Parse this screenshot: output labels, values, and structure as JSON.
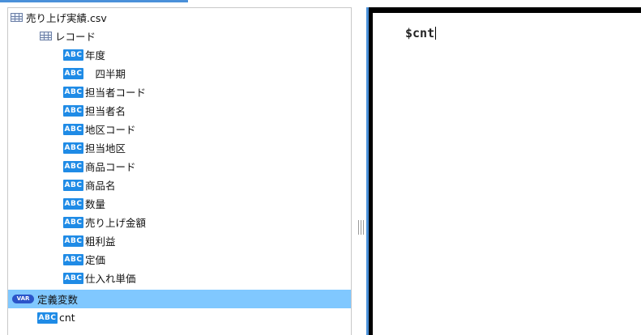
{
  "tree": {
    "file": {
      "icon": "table-icon",
      "label": "売り上げ実績.csv"
    },
    "record": {
      "icon": "table-icon",
      "label": "レコード"
    },
    "fields": [
      {
        "badge": "ABC",
        "label": "年度"
      },
      {
        "badge": "ABC",
        "label": "　四半期"
      },
      {
        "badge": "ABC",
        "label": "担当者コード"
      },
      {
        "badge": "ABC",
        "label": "担当者名"
      },
      {
        "badge": "ABC",
        "label": "地区コード"
      },
      {
        "badge": "ABC",
        "label": "担当地区"
      },
      {
        "badge": "ABC",
        "label": "商品コード"
      },
      {
        "badge": "ABC",
        "label": "商品名"
      },
      {
        "badge": "ABC",
        "label": "数量"
      },
      {
        "badge": "ABC",
        "label": "売り上げ金額"
      },
      {
        "badge": "ABC",
        "label": "粗利益"
      },
      {
        "badge": "ABC",
        "label": "定価"
      },
      {
        "badge": "ABC",
        "label": "仕入れ単価"
      }
    ],
    "variables": {
      "badge": "VAR",
      "label": "定義変数"
    },
    "variable_items": [
      {
        "badge": "ABC",
        "label": "cnt"
      }
    ]
  },
  "editor": {
    "text": "$cnt"
  },
  "colors": {
    "selected": "#80c8ff",
    "badge": "#1f8be6",
    "var_badge": "#2b55c9",
    "accent": "#4a90d9"
  }
}
